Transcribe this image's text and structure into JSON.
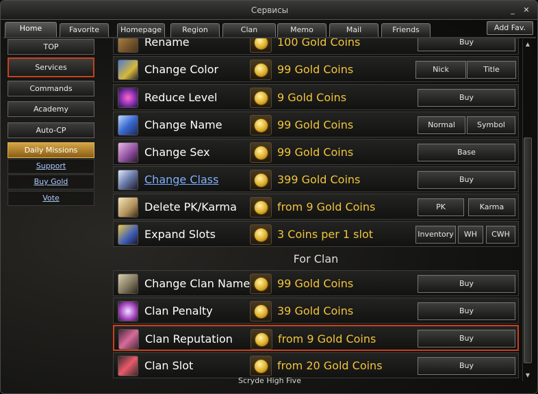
{
  "window": {
    "title": "Сервисы"
  },
  "tabs": [
    "Home",
    "Favorite",
    "Homepage",
    "Region",
    "Clan",
    "Memo",
    "Mail",
    "Friends"
  ],
  "add_fav": "Add Fav.",
  "sidebar": {
    "buttons": [
      "TOP",
      "Services",
      "Commands",
      "Academy",
      "Auto-CP",
      "Daily Missions"
    ],
    "links": [
      "Support",
      "Buy Gold",
      "Vote"
    ]
  },
  "rows": [
    {
      "name": "Rename",
      "price": "100 Gold Coins",
      "buttons": [
        "Buy"
      ]
    },
    {
      "name": "Change Color",
      "price": "99 Gold Coins",
      "buttons": [
        "Nick",
        "Title"
      ]
    },
    {
      "name": "Reduce Level",
      "price": "9 Gold Coins",
      "buttons": [
        "Buy"
      ]
    },
    {
      "name": "Change Name",
      "price": "99 Gold Coins",
      "buttons": [
        "Normal",
        "Symbol"
      ]
    },
    {
      "name": "Change Sex",
      "price": "99 Gold Coins",
      "buttons": [
        "Base"
      ]
    },
    {
      "name": "Change Class",
      "price": "399 Gold Coins",
      "buttons": [
        "Buy"
      ]
    },
    {
      "name": "Delete PK/Karma",
      "price": "from 9 Gold Coins",
      "buttons": [
        "PK",
        "Karma"
      ]
    },
    {
      "name": "Expand Slots",
      "price": "3 Coins per 1 slot",
      "buttons": [
        "Inventory",
        "WH",
        "CWH"
      ]
    }
  ],
  "clan_section": {
    "title": "For Clan"
  },
  "clan_rows": [
    {
      "name": "Change Clan Name",
      "price": "99 Gold Coins",
      "buttons": [
        "Buy"
      ]
    },
    {
      "name": "Clan Penalty",
      "price": "39 Gold Coins",
      "buttons": [
        "Buy"
      ]
    },
    {
      "name": "Clan Reputation",
      "price": "from 9 Gold Coins",
      "buttons": [
        "Buy"
      ]
    },
    {
      "name": "Clan Slot",
      "price": "from 20 Gold Coins",
      "buttons": [
        "Buy"
      ]
    }
  ],
  "footer": "Scryde High Five",
  "colors": {
    "accent_red": "#c9411e",
    "price_gold": "#f2c53a",
    "link_blue": "#7fb0ff"
  }
}
